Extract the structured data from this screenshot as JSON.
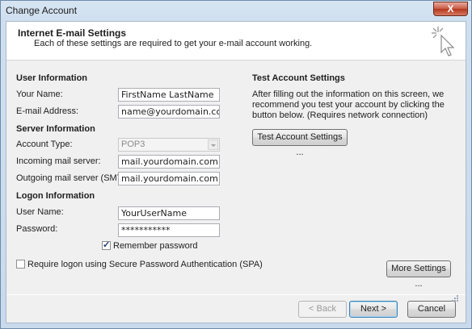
{
  "window": {
    "title": "Change Account",
    "close_label": "X"
  },
  "header": {
    "title": "Internet E-mail Settings",
    "subtitle": "Each of these settings are required to get your e-mail account working.",
    "icon": "cursor-sparkle-icon"
  },
  "user_info": {
    "section": "User Information",
    "name_label": "Your Name:",
    "name_value": "FirstName LastName",
    "email_label": "E-mail Address:",
    "email_value": "name@yourdomain.com"
  },
  "server_info": {
    "section": "Server Information",
    "account_type_label": "Account Type:",
    "account_type_value": "POP3",
    "incoming_label": "Incoming mail server:",
    "incoming_value": "mail.yourdomain.com",
    "outgoing_label": "Outgoing mail server (SMTP):",
    "outgoing_value": "mail.yourdomain.com"
  },
  "logon_info": {
    "section": "Logon Information",
    "username_label": "User Name:",
    "username_value": "YourUserName",
    "password_label": "Password:",
    "password_value": "***********",
    "remember_label": "Remember password",
    "remember_checked": true,
    "spa_label": "Require logon using Secure Password Authentication (SPA)",
    "spa_checked": false
  },
  "test": {
    "section": "Test Account Settings",
    "description": "After filling out the information on this screen, we recommend you test your account by clicking the button below. (Requires network connection)",
    "button": "Test Account Settings ..."
  },
  "more_settings_button": "More Settings ...",
  "footer": {
    "back": "< Back",
    "next": "Next >",
    "cancel": "Cancel"
  }
}
